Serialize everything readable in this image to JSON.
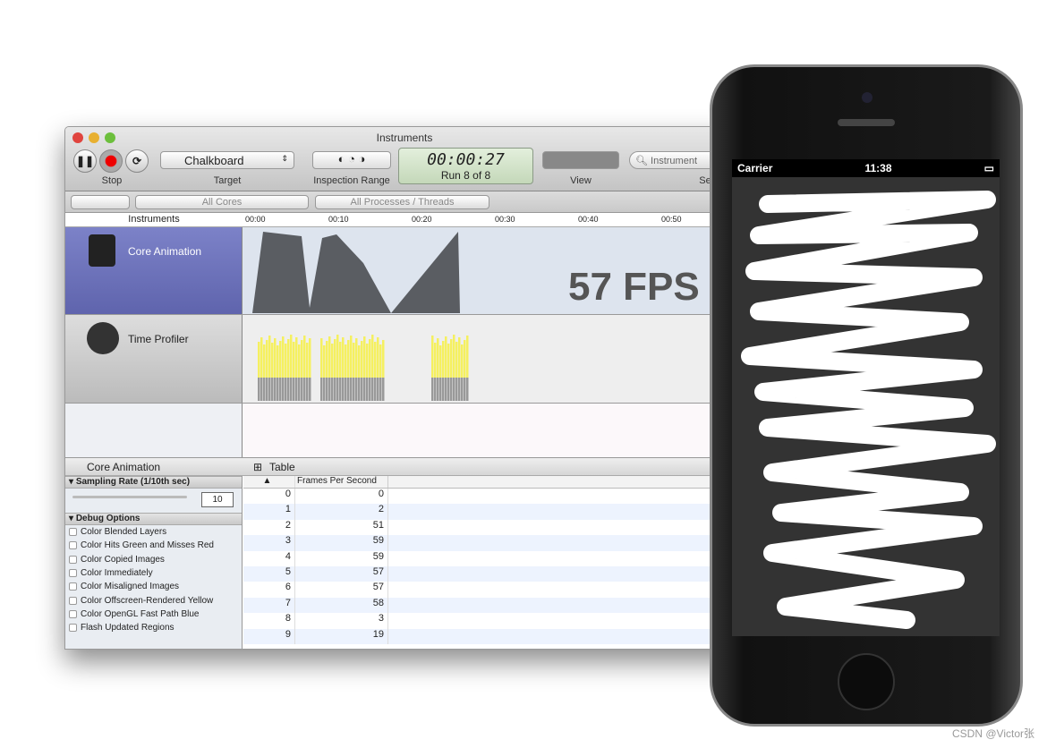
{
  "window": {
    "title": "Instruments"
  },
  "toolbar": {
    "stop_label": "Stop",
    "target_label": "Target",
    "target_value": "Chalkboard",
    "inspection_label": "Inspection Range",
    "timer": "00:00:27",
    "run": "Run 8 of 8",
    "view_label": "View",
    "search_placeholder": "Instrument",
    "search_label_partial": "Se"
  },
  "filterbar": {
    "cores": "All Cores",
    "processes": "All Processes / Threads"
  },
  "ruler": {
    "header": "Instruments",
    "ticks": [
      "00:00",
      "00:10",
      "00:20",
      "00:30",
      "00:40",
      "00:50"
    ]
  },
  "tracks": [
    {
      "name": "Core Animation",
      "overlay": "57 FPS i"
    },
    {
      "name": "Time Profiler"
    }
  ],
  "detail": {
    "instrument": "Core Animation",
    "view": "Table",
    "sampling": {
      "title": "Sampling Rate (1/10th sec)",
      "value": "10"
    },
    "debug": {
      "title": "Debug Options",
      "options": [
        "Color Blended Layers",
        "Color Hits Green and Misses Red",
        "Color Copied Images",
        "Color Immediately",
        "Color Misaligned Images",
        "Color Offscreen-Rendered Yellow",
        "Color OpenGL Fast Path Blue",
        "Flash Updated Regions"
      ]
    },
    "table": {
      "col": "Frames Per Second",
      "rows": [
        [
          "0",
          "0"
        ],
        [
          "1",
          "2"
        ],
        [
          "2",
          "51"
        ],
        [
          "3",
          "59"
        ],
        [
          "4",
          "59"
        ],
        [
          "5",
          "57"
        ],
        [
          "6",
          "57"
        ],
        [
          "7",
          "58"
        ],
        [
          "8",
          "3"
        ],
        [
          "9",
          "19"
        ]
      ]
    }
  },
  "phone": {
    "carrier": "Carrier",
    "time": "11:38"
  },
  "watermark": "CSDN @Victor张",
  "colors": {
    "track_selected": "#6b70b8",
    "cpu_bar": "#f5f060",
    "fps_graph": "#5a5d62"
  }
}
